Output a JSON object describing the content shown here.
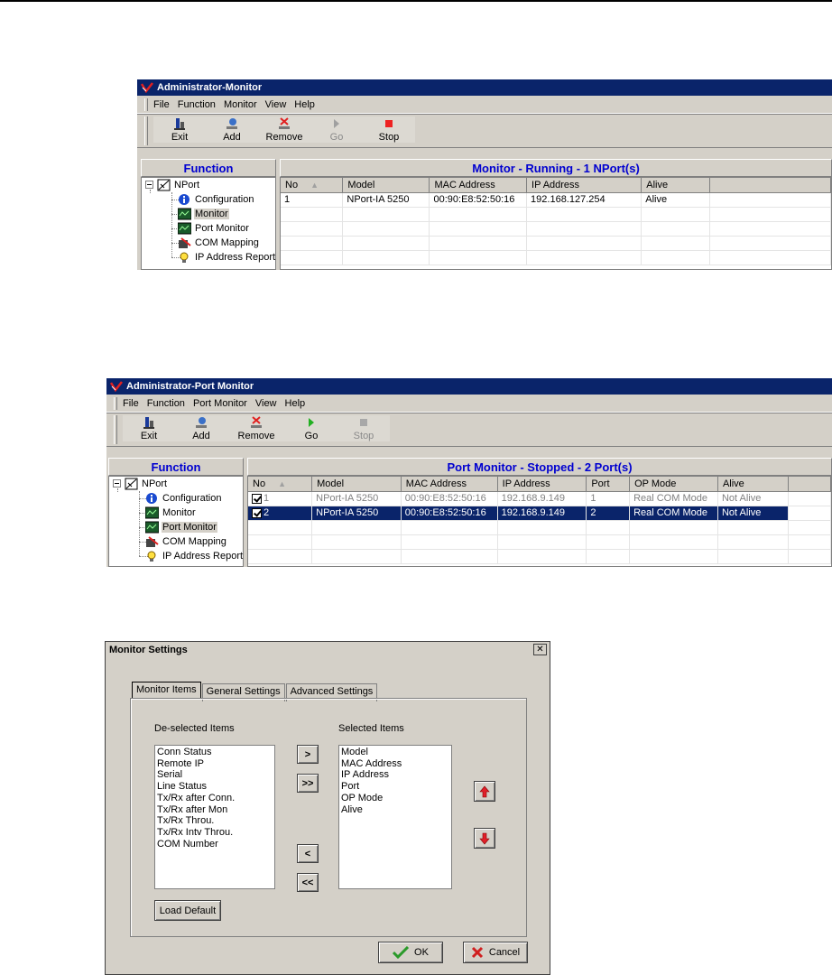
{
  "win1": {
    "title": "Administrator-Monitor",
    "menu": [
      "File",
      "Function",
      "Monitor",
      "View",
      "Help"
    ],
    "toolbar": [
      {
        "label": "Exit",
        "icon": "exit-icon",
        "enabled": true
      },
      {
        "label": "Add",
        "icon": "add-icon",
        "enabled": true
      },
      {
        "label": "Remove",
        "icon": "remove-icon",
        "enabled": true
      },
      {
        "label": "Go",
        "icon": "go-icon",
        "enabled": false
      },
      {
        "label": "Stop",
        "icon": "stop-icon",
        "enabled": true
      }
    ],
    "function_header": "Function",
    "grid_header": "Monitor - Running - 1 NPort(s)",
    "tree": {
      "root": "NPort",
      "items": [
        "Configuration",
        "Monitor",
        "Port Monitor",
        "COM Mapping",
        "IP Address Report"
      ],
      "selected": "Monitor"
    },
    "columns": [
      "No",
      "Model",
      "MAC Address",
      "IP Address",
      "Alive"
    ],
    "rows": [
      [
        "1",
        "NPort-IA 5250",
        "00:90:E8:52:50:16",
        "192.168.127.254",
        "Alive"
      ]
    ]
  },
  "win2": {
    "title": "Administrator-Port Monitor",
    "menu": [
      "File",
      "Function",
      "Port Monitor",
      "View",
      "Help"
    ],
    "toolbar": [
      {
        "label": "Exit",
        "icon": "exit-icon",
        "enabled": true
      },
      {
        "label": "Add",
        "icon": "add-icon",
        "enabled": true
      },
      {
        "label": "Remove",
        "icon": "remove-icon",
        "enabled": true
      },
      {
        "label": "Go",
        "icon": "go-icon",
        "enabled": true
      },
      {
        "label": "Stop",
        "icon": "stop-icon",
        "enabled": false
      }
    ],
    "function_header": "Function",
    "grid_header": "Port Monitor - Stopped - 2 Port(s)",
    "tree": {
      "root": "NPort",
      "items": [
        "Configuration",
        "Monitor",
        "Port Monitor",
        "COM Mapping",
        "IP Address Report"
      ],
      "selected": "Port Monitor"
    },
    "columns": [
      "No",
      "Model",
      "MAC Address",
      "IP Address",
      "Port",
      "OP Mode",
      "Alive"
    ],
    "rows": [
      [
        "1",
        "NPort-IA 5250",
        "00:90:E8:52:50:16",
        "192.168.9.149",
        "1",
        "Real COM Mode",
        "Not Alive"
      ],
      [
        "2",
        "NPort-IA 5250",
        "00:90:E8:52:50:16",
        "192.168.9.149",
        "2",
        "Real COM Mode",
        "Not Alive"
      ]
    ],
    "selected_row": 1
  },
  "dialog": {
    "title": "Monitor Settings",
    "close": "✕",
    "tabs": [
      "Monitor Items",
      "General Settings",
      "Advanced Settings"
    ],
    "active_tab": "Monitor Items",
    "deselected_label": "De-selected Items",
    "selected_label": "Selected Items",
    "deselected_items": [
      "Conn Status",
      "Remote IP",
      "Serial",
      "Line Status",
      "Tx/Rx after Conn.",
      "Tx/Rx after Mon",
      "Tx/Rx Throu.",
      "Tx/Rx Intv Throu.",
      "COM Number"
    ],
    "selected_items": [
      "Model",
      "MAC Address",
      "IP Address",
      "Port",
      "OP Mode",
      "Alive"
    ],
    "move_buttons": [
      ">",
      ">>",
      "<",
      "<<"
    ],
    "load_default": "Load Default",
    "ok": "OK",
    "cancel": "Cancel",
    "colors": {
      "up_down_arrow": "#e0202a",
      "ok_check": "#2a9a2a",
      "cancel_x": "#d02020"
    }
  },
  "colors": {
    "title_bar": "#0a246a",
    "header_blue": "#0000d0",
    "face": "#d4d0c8"
  }
}
